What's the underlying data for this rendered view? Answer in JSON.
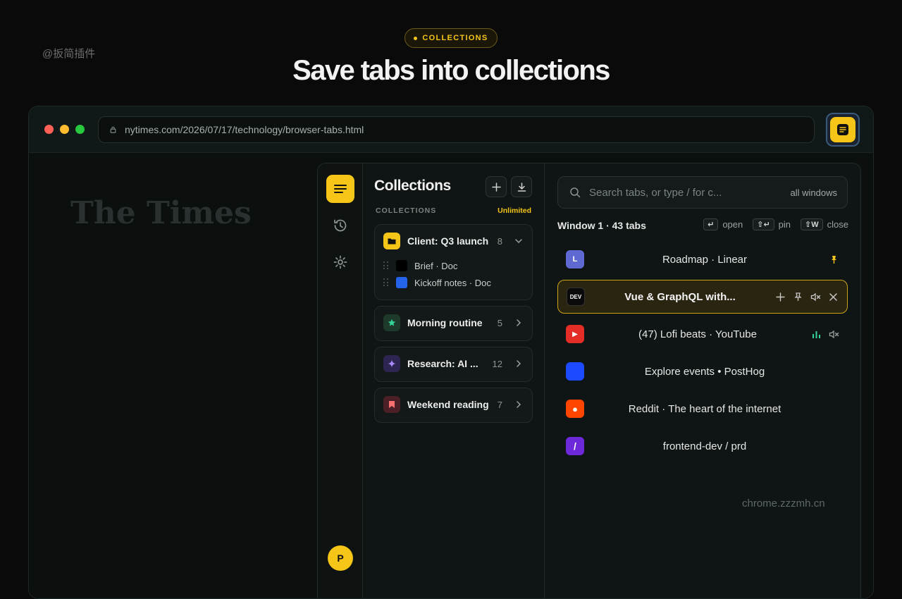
{
  "watermark_top_left": "@扳简插件",
  "badge": {
    "label": "COLLECTIONS"
  },
  "headline": "Save tabs into collections",
  "browser": {
    "url": "nytimes.com/2026/07/17/technology/browser-tabs.html",
    "page_masthead": "The Times",
    "accent_color": "#f5c518"
  },
  "collections_pane": {
    "title": "Collections",
    "section_label": "COLLECTIONS",
    "plan_tag": "Unlimited",
    "collections": [
      {
        "name": "Client: Q3 launch",
        "count": "8",
        "icon": "folder-icon",
        "expanded": true,
        "items": [
          {
            "label": "Brief · Doc",
            "color": "#000000"
          },
          {
            "label": "Kickoff notes · Doc",
            "color": "#2563eb"
          }
        ]
      },
      {
        "name": "Morning routine",
        "count": "5",
        "icon": "star-icon"
      },
      {
        "name": "Research: AI ...",
        "count": "12",
        "icon": "sparkle-icon"
      },
      {
        "name": "Weekend reading",
        "count": "7",
        "icon": "bookmark-icon"
      }
    ]
  },
  "tabs_pane": {
    "search_placeholder": "Search tabs, or type / for c...",
    "search_scope": "all windows",
    "window_label": "Window 1 · 43 tabs",
    "hints": [
      {
        "key": "↵",
        "label": "open"
      },
      {
        "key": "⇧↵",
        "label": "pin"
      },
      {
        "key": "⇧W",
        "label": "close"
      }
    ],
    "tabs": [
      {
        "title": "Roadmap · Linear",
        "favicon_text": "L",
        "favicon_color": "#5e6ad2",
        "state": "pinned"
      },
      {
        "title": "Vue & GraphQL with...",
        "favicon_text": "DEV",
        "favicon_color": "#0a0a0a",
        "state": "active"
      },
      {
        "title": "(47) Lofi beats · YouTube",
        "favicon_text": "▶",
        "favicon_color": "#e52d27",
        "state": "playing"
      },
      {
        "title": "Explore events • PostHog",
        "favicon_text": "",
        "favicon_color": "#1d4aff",
        "state": ""
      },
      {
        "title": "Reddit · The heart of the internet",
        "favicon_text": "●",
        "favicon_color": "#ff4500",
        "state": ""
      },
      {
        "title": "frontend-dev / prd",
        "favicon_text": "/",
        "favicon_color": "#6d28d9",
        "state": ""
      }
    ]
  },
  "avatar_initial": "P",
  "watermark_site": "chrome.zzzmh.cn"
}
